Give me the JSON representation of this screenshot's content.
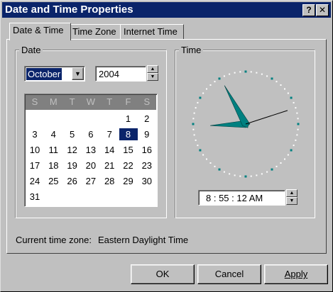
{
  "window": {
    "title": "Date and Time Properties",
    "help_glyph": "?",
    "close_glyph": "✕"
  },
  "tabs": [
    {
      "label": "Date & Time",
      "active": true
    },
    {
      "label": "Time Zone",
      "active": false
    },
    {
      "label": "Internet Time",
      "active": false
    }
  ],
  "date_group": {
    "label": "Date",
    "month": "October",
    "year": "2004",
    "weekday_headers": [
      "S",
      "M",
      "T",
      "W",
      "T",
      "F",
      "S"
    ],
    "first_weekday_index": 5,
    "days_in_month": 31,
    "selected_day": 8
  },
  "time_group": {
    "label": "Time",
    "time_value": "8 : 55 : 12 AM",
    "hour": 8,
    "minute": 55,
    "second": 12
  },
  "timezone": {
    "label": "Current time zone:",
    "value": "Eastern Daylight Time"
  },
  "buttons": {
    "ok": "OK",
    "cancel": "Cancel",
    "apply": "Apply"
  },
  "colors": {
    "titlebar": "#0a246a",
    "selection": "#0a246a",
    "clock_hands": "#008080",
    "face": "#c0c0c0"
  }
}
